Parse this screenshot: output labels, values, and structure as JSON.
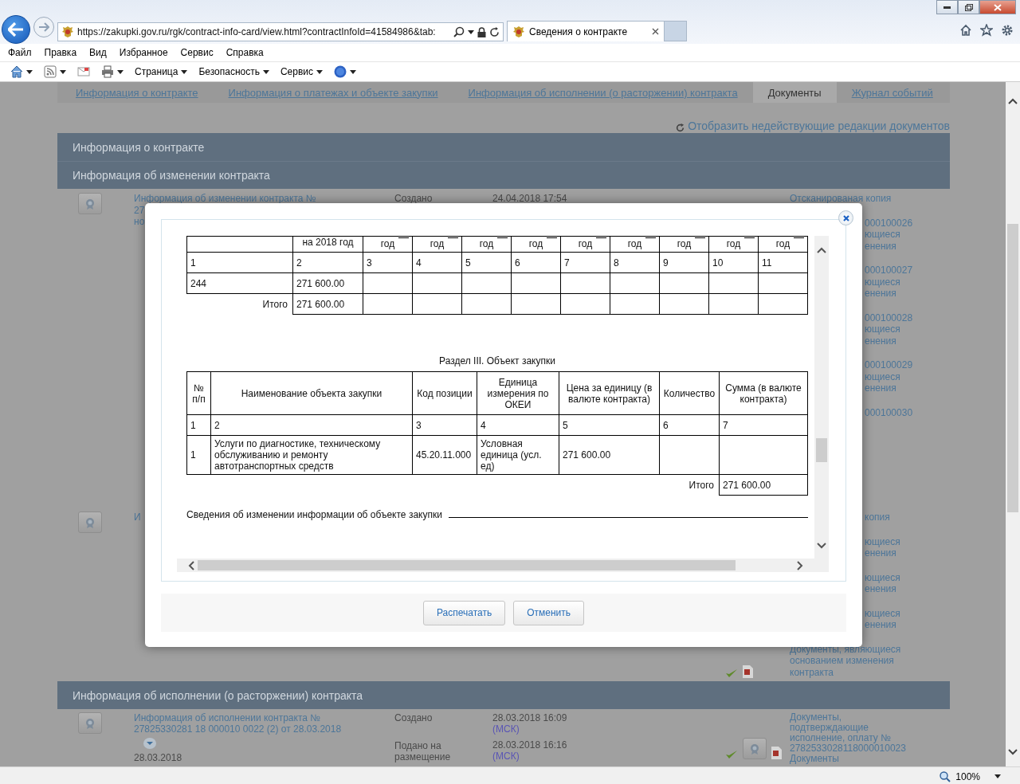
{
  "browser": {
    "address": "https://zakupki.gov.ru/rgk/contract-info-card/view.html?contractInfoId=41584986&tab:",
    "tab_title": "Сведения о контракте",
    "menu": [
      "Файл",
      "Правка",
      "Вид",
      "Избранное",
      "Сервис",
      "Справка"
    ],
    "toolbar": [
      "Страница",
      "Безопасность",
      "Сервис"
    ],
    "zoom": "100%"
  },
  "page_tabs": [
    {
      "label": "Информация о контракте",
      "selected": false
    },
    {
      "label": "Информация о платежах и объекте закупки",
      "selected": false
    },
    {
      "label": "Информация об исполнении (о расторжении) контракта",
      "selected": false
    },
    {
      "label": "Документы",
      "selected": true
    },
    {
      "label": "Журнал событий",
      "selected": false
    }
  ],
  "show_old_link": "Отобразить недействующие редакции документов",
  "section_contract": {
    "title": "Информация о контракте"
  },
  "section_changes": {
    "title": "Информация об изменении контракта",
    "entries": [
      {
        "link_lines": [
          "Информация об изменении контракта №",
          "27",
          "но"
        ],
        "label": "Создано",
        "datetime": "24.04.2018 17:54",
        "docs": [
          {
            "kind": "link",
            "lines": [
              "Отсканированая копия"
            ]
          },
          {
            "kind": "fragment",
            "lines": [
              "000100026",
              "ющиеся",
              "енения"
            ]
          },
          {
            "kind": "fragment",
            "lines": [
              "000100027",
              "ющиеся",
              "енения"
            ]
          },
          {
            "kind": "fragment",
            "lines": [
              "000100028",
              "ющиеся",
              "енения"
            ]
          },
          {
            "kind": "fragment",
            "lines": [
              "000100029",
              "ющиеся",
              "енения"
            ]
          },
          {
            "kind": "fragment",
            "lines": [
              "000100030"
            ]
          }
        ]
      },
      {
        "link_lines": [
          "И"
        ],
        "signed": true,
        "docs": [
          {
            "kind": "fragment",
            "lines": [
              "копия"
            ]
          },
          {
            "kind": "fragment",
            "lines": [
              "ющиеся",
              "енения"
            ]
          },
          {
            "kind": "fragment",
            "lines": [
              "ющиеся",
              "енения"
            ]
          },
          {
            "kind": "fragment",
            "lines": [
              "ющиеся",
              "енения"
            ]
          },
          {
            "kind": "link",
            "lines": [
              "Документы, являющиеся",
              "основанием изменения",
              "контракта"
            ]
          }
        ]
      }
    ]
  },
  "section_execution": {
    "title": "Информация об исполнении (о расторжении) контракта",
    "entry": {
      "link_lines": [
        "Информация об исполнении контракта №",
        "27825330281 18 000010 0022 (2) от 28.03.2018"
      ],
      "date": "28.03.2018",
      "signed": true,
      "events": [
        {
          "label_lines": [
            "Создано"
          ],
          "datetime": "28.03.2018 16:09",
          "tz": "(МСК)"
        },
        {
          "label_lines": [
            "Подано на",
            "размещение"
          ],
          "datetime": "28.03.2018 16:16",
          "tz": "(МСК)"
        }
      ],
      "docs_lines": [
        "Документы,",
        "подтверждающие",
        "исполнение, оплату №",
        "2782533028118000010023",
        "Документы"
      ]
    }
  },
  "modal": {
    "table1": {
      "header": [
        "на  2018  год",
        "год",
        "год",
        "год",
        "год",
        "год",
        "год",
        "год",
        "год",
        "год"
      ],
      "number_row": [
        "1",
        "2",
        "3",
        "4",
        "5",
        "6",
        "7",
        "8",
        "9",
        "10",
        "11"
      ],
      "rows": [
        [
          "244",
          "271 600.00"
        ]
      ],
      "total": {
        "label": "Итого",
        "values": [
          "271 600.00"
        ]
      }
    },
    "section_title": "Раздел III. Объект закупки",
    "table2": {
      "header": [
        "№ п/п",
        "Наименование объекта закупки",
        "Код позиции",
        "Единица измерения по ОКЕИ",
        "Цена за единицу (в валюте контракта)",
        "Количество",
        "Сумма (в валюте контракта)"
      ],
      "number_row": [
        "1",
        "2",
        "3",
        "4",
        "5",
        "6",
        "7"
      ],
      "rows": [
        [
          "1",
          "Услуги по диагностике, техническому обслуживанию и ремонту автотранспортных средств",
          "45.20.11.000",
          "Условная единица (усл. ед)",
          "271 600.00"
        ]
      ],
      "total": {
        "label": "Итого",
        "value": "271 600.00"
      }
    },
    "change_note": "Сведения об изменении информации об объекте закупки",
    "buttons": [
      "Распечатать",
      "Отменить"
    ]
  }
}
